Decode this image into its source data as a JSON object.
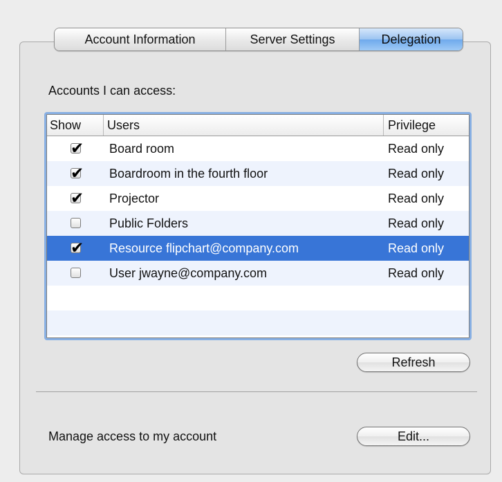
{
  "tabs": [
    {
      "label": "Account Information",
      "selected": false
    },
    {
      "label": "Server Settings",
      "selected": false
    },
    {
      "label": "Delegation",
      "selected": true
    }
  ],
  "accounts_section": {
    "label": "Accounts I can access:",
    "table": {
      "columns": [
        "Show",
        "Users",
        "Privilege"
      ],
      "rows": [
        {
          "show": true,
          "user": "Board room",
          "privilege": "Read only",
          "selected": false
        },
        {
          "show": true,
          "user": "Boardroom in the fourth floor",
          "privilege": "Read only",
          "selected": false
        },
        {
          "show": true,
          "user": "Projector",
          "privilege": "Read only",
          "selected": false
        },
        {
          "show": false,
          "user": "Public Folders",
          "privilege": "Read only",
          "selected": false
        },
        {
          "show": true,
          "user": "Resource flipchart@company.com",
          "privilege": "Read only",
          "selected": true
        },
        {
          "show": false,
          "user": "User jwayne@company.com",
          "privilege": "Read only",
          "selected": false
        }
      ]
    },
    "refresh_label": "Refresh"
  },
  "manage_section": {
    "label": "Manage access to my account",
    "edit_label": "Edit..."
  },
  "colors": {
    "selected_row": "#3875d7",
    "alt_row": "#eef3fd",
    "tab_selected": "#9cc4f1",
    "focus_ring": "#87afe3"
  }
}
